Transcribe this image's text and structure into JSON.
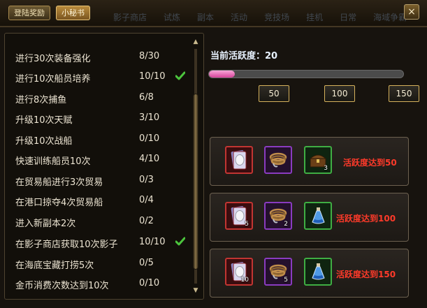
{
  "tabs": {
    "login_reward": "登陆奖励",
    "secret_book": "小秘书"
  },
  "background_tabs": [
    "影子商店",
    "试炼",
    "副本",
    "活动",
    "竞技场",
    "挂机",
    "日常",
    "海域争霸"
  ],
  "close_label": "×",
  "tasks": [
    {
      "name": "进行30次装备强化",
      "count": "8/30",
      "done": false
    },
    {
      "name": "进行10次船员培养",
      "count": "10/10",
      "done": true
    },
    {
      "name": "进行8次捕鱼",
      "count": "6/8",
      "done": false
    },
    {
      "name": "升级10次天赋",
      "count": "3/10",
      "done": false
    },
    {
      "name": "升级10次战船",
      "count": "0/10",
      "done": false
    },
    {
      "name": "快速训练船员10次",
      "count": "4/10",
      "done": false
    },
    {
      "name": "在贸易船进行3次贸易",
      "count": "0/3",
      "done": false
    },
    {
      "name": "在港口掠夺4次贸易船",
      "count": "0/4",
      "done": false
    },
    {
      "name": "进入新副本2次",
      "count": "0/2",
      "done": false
    },
    {
      "name": "在影子商店获取10次影子",
      "count": "10/10",
      "done": true
    },
    {
      "name": "在海底宝藏打捞5次",
      "count": "0/5",
      "done": false
    },
    {
      "name": "金币消费次数达到10次",
      "count": "0/10",
      "done": false
    }
  ],
  "activity": {
    "label": "当前活跃度：20",
    "value": 20,
    "max": 150,
    "milestones": [
      "50",
      "100",
      "150"
    ]
  },
  "rewards": [
    {
      "label": "活跃度达到50",
      "items": [
        {
          "icon": "card-icon",
          "frame": "red",
          "qty": ""
        },
        {
          "icon": "rope-icon",
          "frame": "purple",
          "qty": ""
        },
        {
          "icon": "chest-icon",
          "frame": "green",
          "qty": "3"
        }
      ]
    },
    {
      "label": "活跃度达到100",
      "items": [
        {
          "icon": "egg-card-icon",
          "frame": "red",
          "qty": "5"
        },
        {
          "icon": "rope-icon",
          "frame": "purple",
          "qty": "2"
        },
        {
          "icon": "potion-icon",
          "frame": "green",
          "qty": ""
        }
      ]
    },
    {
      "label": "活跃度达到150",
      "items": [
        {
          "icon": "egg-card-icon",
          "frame": "red",
          "qty": "10"
        },
        {
          "icon": "rope-icon",
          "frame": "purple",
          "qty": "5"
        },
        {
          "icon": "potion-icon",
          "frame": "green",
          "qty": ""
        }
      ]
    }
  ],
  "colors": {
    "progress_fill": "#e060ae",
    "reward_label": "#ff3a2a",
    "milestone_border": "#d6b25c",
    "check": "#4cc53d"
  }
}
